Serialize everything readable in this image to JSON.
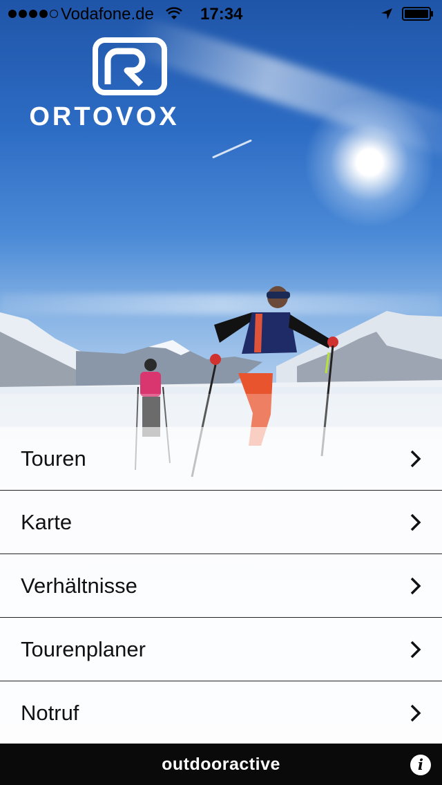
{
  "status_bar": {
    "carrier": "Vodafone.de",
    "time": "17:34",
    "signal_bars_filled": 4,
    "signal_bars_total": 5,
    "icons": [
      "wifi-icon",
      "location-arrow-icon",
      "battery-icon"
    ]
  },
  "logo": {
    "brand": "ORTOVOX"
  },
  "menu": {
    "items": [
      {
        "label": "Touren",
        "icon": "chevron-right-icon"
      },
      {
        "label": "Karte",
        "icon": "chevron-right-icon"
      },
      {
        "label": "Verhältnisse",
        "icon": "chevron-right-icon"
      },
      {
        "label": "Tourenplaner",
        "icon": "chevron-right-icon"
      },
      {
        "label": "Notruf",
        "icon": "chevron-right-icon"
      }
    ]
  },
  "footer": {
    "brand": "outdooractive",
    "info_icon": "info-icon",
    "info_glyph": "i"
  },
  "colors": {
    "sky": "#2d6cc4",
    "footer_bg": "#0a0a0a",
    "menu_text": "#111111",
    "divider": "#222222"
  }
}
